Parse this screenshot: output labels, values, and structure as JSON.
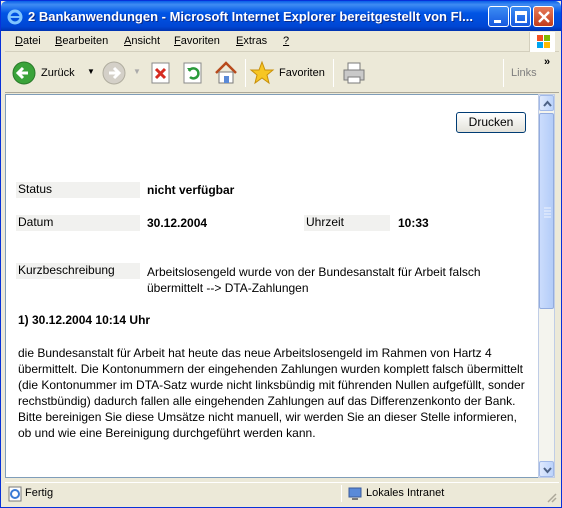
{
  "window": {
    "title": "2 Bankanwendungen - Microsoft Internet Explorer bereitgestellt von Fl..."
  },
  "menu": {
    "items": [
      {
        "first": "D",
        "rest": "atei"
      },
      {
        "first": "B",
        "rest": "earbeiten"
      },
      {
        "first": "A",
        "rest": "nsicht"
      },
      {
        "first": "F",
        "rest": "avoriten"
      },
      {
        "first": "E",
        "rest": "xtras"
      },
      {
        "first": "?",
        "rest": ""
      }
    ]
  },
  "toolbar": {
    "back_label": "Zurück",
    "favorites_label": "Favoriten",
    "links_label": "Links",
    "overflow": "»"
  },
  "page": {
    "print_button": "Drucken",
    "status_label": "Status",
    "status_value": "nicht verfügbar",
    "date_label": "Datum",
    "date_value": "30.12.2004",
    "time_label": "Uhrzeit",
    "time_value": "10:33",
    "summary_label": "Kurzbeschreibung",
    "summary_value": "Arbeitslosengeld wurde von der Bundesanstalt für Arbeit falsch übermittelt --> DTA-Zahlungen",
    "entry_heading": "1) 30.12.2004 10:14 Uhr",
    "entry_body_1": "die Bundesanstalt für Arbeit hat heute das neue Arbeitslosengeld im Rahmen von Hartz 4 übermittelt. Die Kontonummern der eingehenden Zahlungen wurden komplett falsch übermittelt (die Kontonummer im DTA-Satz wurde nicht linksbündig mit führenden Nullen aufgefüllt, sonder rechstbündig) dadurch fallen alle eingehenden Zahlungen auf das Differenzenkonto der Bank.",
    "entry_body_2": "Bitte bereinigen Sie diese Umsätze nicht manuell, wir werden Sie an dieser Stelle informieren, ob und wie eine Bereinigung durchgeführt werden kann."
  },
  "statusbar": {
    "left": "Fertig",
    "zone": "Lokales Intranet"
  },
  "colors": {
    "titlebar": "#0055e5",
    "chrome": "#ece9d8",
    "close_button": "#c23c1a"
  }
}
